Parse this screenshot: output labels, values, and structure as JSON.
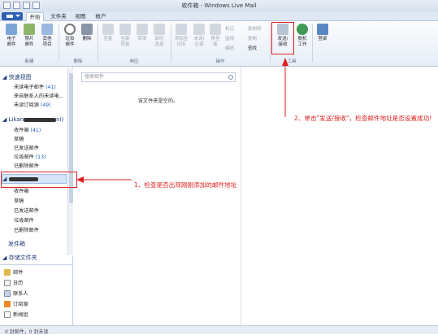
{
  "window": {
    "title": "收件箱 - Windows Live Mail"
  },
  "tabs": [
    "开始",
    "文件夹",
    "视图",
    "帐户"
  ],
  "ribbon": {
    "new_group": {
      "buttons": [
        "电子\n邮件",
        "照片\n邮件",
        "其他\n项目"
      ],
      "label": "新建"
    },
    "delete_group": {
      "buttons": [
        "垃圾\n邮件",
        "删除"
      ],
      "label": "删除"
    },
    "respond_group": {
      "buttons": [
        "答复",
        "全部\n答复",
        "转发",
        "即时\n消息"
      ],
      "label": "响应"
    },
    "actions_group": {
      "buttons": [
        "添加至\n日历",
        "未读/\n已读",
        "移至\n收"
      ],
      "small_left": [
        "标记",
        "监视",
        "编码"
      ],
      "small_right": [
        "复制到",
        "复制",
        "查找"
      ],
      "label": "操作"
    },
    "tools_group": {
      "buttons": [
        "发送/\n接收",
        "脱机\n工作"
      ],
      "label": "工具"
    },
    "login_button": "登录"
  },
  "left_pane": {
    "quick_views": {
      "header": "快速视图",
      "items": [
        {
          "label": "未读电子邮件",
          "count": "(41)"
        },
        {
          "label": "来自联系人的未读电...",
          "count": ""
        },
        {
          "label": "未读订阅源",
          "count": "(49)"
        }
      ]
    },
    "account1": {
      "header": "Likan",
      "suffix": "ni)",
      "folders": [
        {
          "label": "收件箱",
          "count": "(41)"
        },
        {
          "label": "草稿",
          "count": ""
        },
        {
          "label": "已发送邮件",
          "count": ""
        },
        {
          "label": "垃圾邮件",
          "count": "(13)"
        },
        {
          "label": "已删除邮件",
          "count": ""
        }
      ]
    },
    "account2": {
      "folders": [
        "收件箱",
        "草稿",
        "已发送邮件",
        "垃圾邮件",
        "已删除邮件"
      ]
    },
    "outbox": "发件箱",
    "storage": "存储文件夹",
    "nav": [
      "邮件",
      "日历",
      "联系人",
      "订阅源",
      "新闻组"
    ]
  },
  "message_list": {
    "search_placeholder": "搜索邮件",
    "empty_text": "该文件夹是空的。"
  },
  "status_bar": {
    "text": "0 封邮件，0 封未读"
  },
  "annotations": {
    "note1": "1、检查是否出现刚刚添加的邮件地址",
    "note2": "2、单击\"发送/接收\"，检查邮件地址是否设置成功!"
  },
  "colors": {
    "annotation_red": "#e02020",
    "accent_blue": "#2e61b3",
    "selection": "#d6e6fa"
  }
}
